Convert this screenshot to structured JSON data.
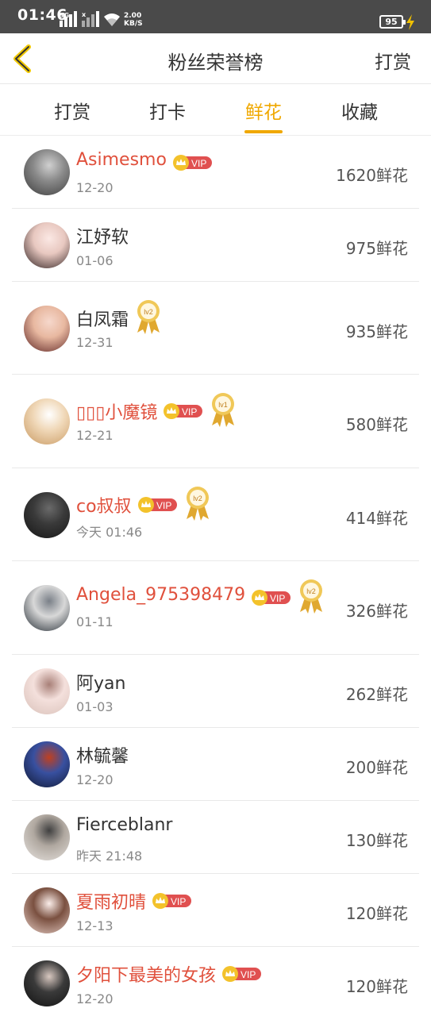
{
  "status_bar": {
    "time": "01:46",
    "net_label_1": "3G",
    "net_label_2": "x",
    "speed_value": "2.00",
    "speed_unit": "KB/S",
    "battery": "95"
  },
  "nav": {
    "title": "粉丝荣誉榜",
    "right_label": "打赏"
  },
  "tabs": [
    {
      "label": "打赏"
    },
    {
      "label": "打卡"
    },
    {
      "label": "鲜花"
    },
    {
      "label": "收藏"
    }
  ],
  "active_tab": 2,
  "accent_color": "#f0a800",
  "vip_name_color": "#e0503c",
  "vip_badge_label": "VIP",
  "fans": [
    {
      "name": "Asimesmo",
      "date": "12-20",
      "count": "1620鲜花",
      "vip": true,
      "medal": ""
    },
    {
      "name": "江妤软",
      "date": "01-06",
      "count": "975鲜花",
      "vip": false,
      "medal": ""
    },
    {
      "name": "白凤霜",
      "date": "12-31",
      "count": "935鲜花",
      "vip": false,
      "medal": "lv2"
    },
    {
      "name": "▯▯▯小魔镜",
      "date": "12-21",
      "count": "580鲜花",
      "vip": true,
      "medal": "lv1"
    },
    {
      "name": "co叔叔",
      "date": "今天 01:46",
      "count": "414鲜花",
      "vip": true,
      "medal": "lv2"
    },
    {
      "name": "Angela_975398479",
      "date": "01-11",
      "count": "326鲜花",
      "vip": true,
      "medal": "lv2"
    },
    {
      "name": "阿yan",
      "date": "01-03",
      "count": "262鲜花",
      "vip": false,
      "medal": ""
    },
    {
      "name": "林毓馨",
      "date": "12-20",
      "count": "200鲜花",
      "vip": false,
      "medal": ""
    },
    {
      "name": "Fierceblanr",
      "date": "昨天 21:48",
      "count": "130鲜花",
      "vip": false,
      "medal": ""
    },
    {
      "name": "夏雨初晴",
      "date": "12-13",
      "count": "120鲜花",
      "vip": true,
      "medal": ""
    },
    {
      "name": "夕阳下最美的女孩",
      "date": "12-20",
      "count": "120鲜花",
      "vip": true,
      "medal": ""
    }
  ]
}
